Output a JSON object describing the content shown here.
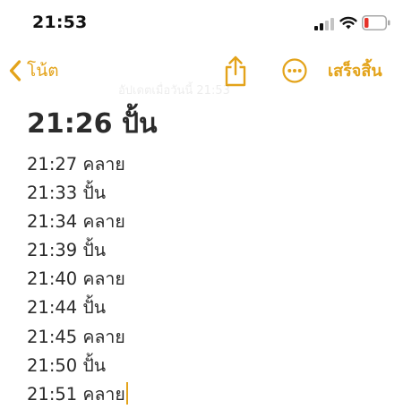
{
  "status_bar": {
    "time": "21:53",
    "icons": [
      "cellular-signal-icon",
      "wifi-icon",
      "battery-low-icon"
    ]
  },
  "nav": {
    "back_label": "โน้ต",
    "done_label": "เสร็จสิ้น",
    "share_icon": "share-icon",
    "more_icon": "more-ellipsis-icon",
    "faded_caption": "อัปเดตเมื่อวันนี้ 21:53"
  },
  "note": {
    "title": "21:26 ปั้น",
    "lines": [
      "21:27 คลาย",
      "21:33 ปั้น",
      "21:34 คลาย",
      "21:39 ปั้น",
      "21:40 คลาย",
      "21:44 ปั้น",
      "21:45 คลาย",
      "21:50 ปั้น",
      "21:51 คลาย"
    ]
  },
  "colors": {
    "accent": "#e3a31a",
    "text": "#2b2b2b",
    "battery_low": "#e5332a",
    "background": "#ffffff"
  }
}
